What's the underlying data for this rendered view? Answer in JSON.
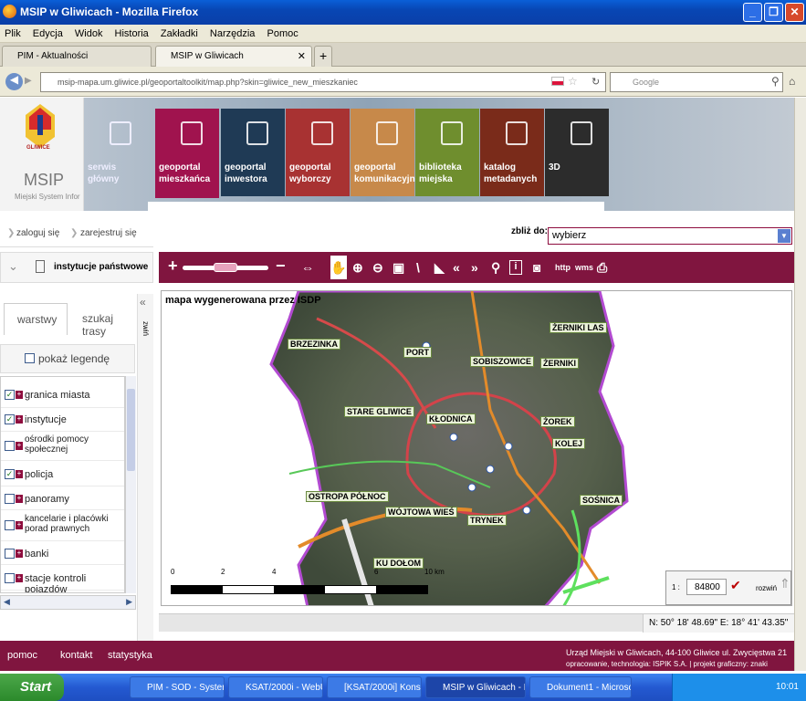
{
  "window": {
    "title": "MSIP w Gliwicach - Mozilla Firefox"
  },
  "menu": [
    "Plik",
    "Edycja",
    "Widok",
    "Historia",
    "Zakładki",
    "Narzędzia",
    "Pomoc"
  ],
  "tabs": [
    {
      "label": "PIM - Aktualności"
    },
    {
      "label": "MSIP w Gliwicach"
    }
  ],
  "nav": {
    "url": "msip-mapa.um.gliwice.pl/geoportaltoolkit/map.php?skin=gliwice_new_mieszkaniec",
    "search_placeholder": "Google"
  },
  "header": {
    "logo_text": "GLIWICE",
    "msip": "MSIP",
    "msip_sub": "Miejski System Infor",
    "tiles": [
      "serwis główny",
      "geoportal mieszkańca",
      "geoportal inwestora",
      "geoportal wyborczy",
      "geoportal komunikacyjny",
      "biblioteka miejska",
      "katalog metadanych",
      "3D"
    ]
  },
  "auth": {
    "login": "zaloguj się",
    "register": "zarejestruj się"
  },
  "zoom": {
    "label": "zbliż do:",
    "value": "wybierz"
  },
  "left": {
    "category": "instytucje państwowe",
    "tab_layers": "warstwy",
    "tab_search": "szukaj trasy",
    "collapse": "zwiń",
    "legend": "pokaż legendę",
    "layers": [
      {
        "label": "granica miasta",
        "checked": true
      },
      {
        "label": "instytucje",
        "checked": true
      },
      {
        "label": "ośrodki pomocy społecznej",
        "checked": false
      },
      {
        "label": "policja",
        "checked": true
      },
      {
        "label": "panoramy",
        "checked": false
      },
      {
        "label": "kancelarie i placówki porad prawnych",
        "checked": false
      },
      {
        "label": "banki",
        "checked": false
      },
      {
        "label": "stacje kontroli pojazdów",
        "checked": false
      }
    ]
  },
  "toolbar": {
    "http": "http",
    "wms": "wms"
  },
  "map": {
    "caption": "mapa wygenerowana przez ISDP",
    "districts": [
      "BRZEZINKA",
      "PORT",
      "SOBISZOWICE",
      "ŻERNIKI LAS",
      "ŻERNIKI",
      "STARE GLIWICE",
      "KŁODNICA",
      "ŻOREK",
      "KOLEJ",
      "OSTROPA PÓŁNOC",
      "WÓJTOWA WIEŚ",
      "TRYNEK",
      "SOŚNICA",
      "KU DOŁOM"
    ],
    "scale_ticks": [
      "0",
      "2",
      "4",
      "6"
    ],
    "scale_unit": "10 km",
    "scale_label": "1 :",
    "scale_value": "84800",
    "expand": "rozwiń"
  },
  "status": {
    "coords": "N: 50° 18' 48.69\" E: 18° 41' 43.35\""
  },
  "footer": {
    "help": "pomoc",
    "contact": "kontakt",
    "stats": "statystyka",
    "address": "Urząd Miejski w Gliwicach, 44-100 Gliwice ul. Zwycięstwa 21",
    "credits": "opracowanie, technologia: ISPIK S.A. | projekt graficzny: znaki"
  },
  "taskbar": {
    "start": "Start",
    "tasks": [
      "PIM - SOD - System ...",
      "KSAT/2000i - WebUtil...",
      "[KSAT/2000i] Konsola...",
      "MSIP w Gliwicach - M...",
      "Dokument1 - Microsof..."
    ],
    "clock": "10:01"
  },
  "colors": {
    "brand": "#80153f",
    "tile_mieszkanca": "#a0134e",
    "tile_inwestora": "#1f3a55",
    "tile_wyborczy": "#a83232",
    "tile_komunikacyjny": "#c7894a",
    "tile_biblioteka": "#6f8e2e",
    "tile_katalog": "#7a2b1a",
    "tile_3d": "#2c2c2c"
  }
}
